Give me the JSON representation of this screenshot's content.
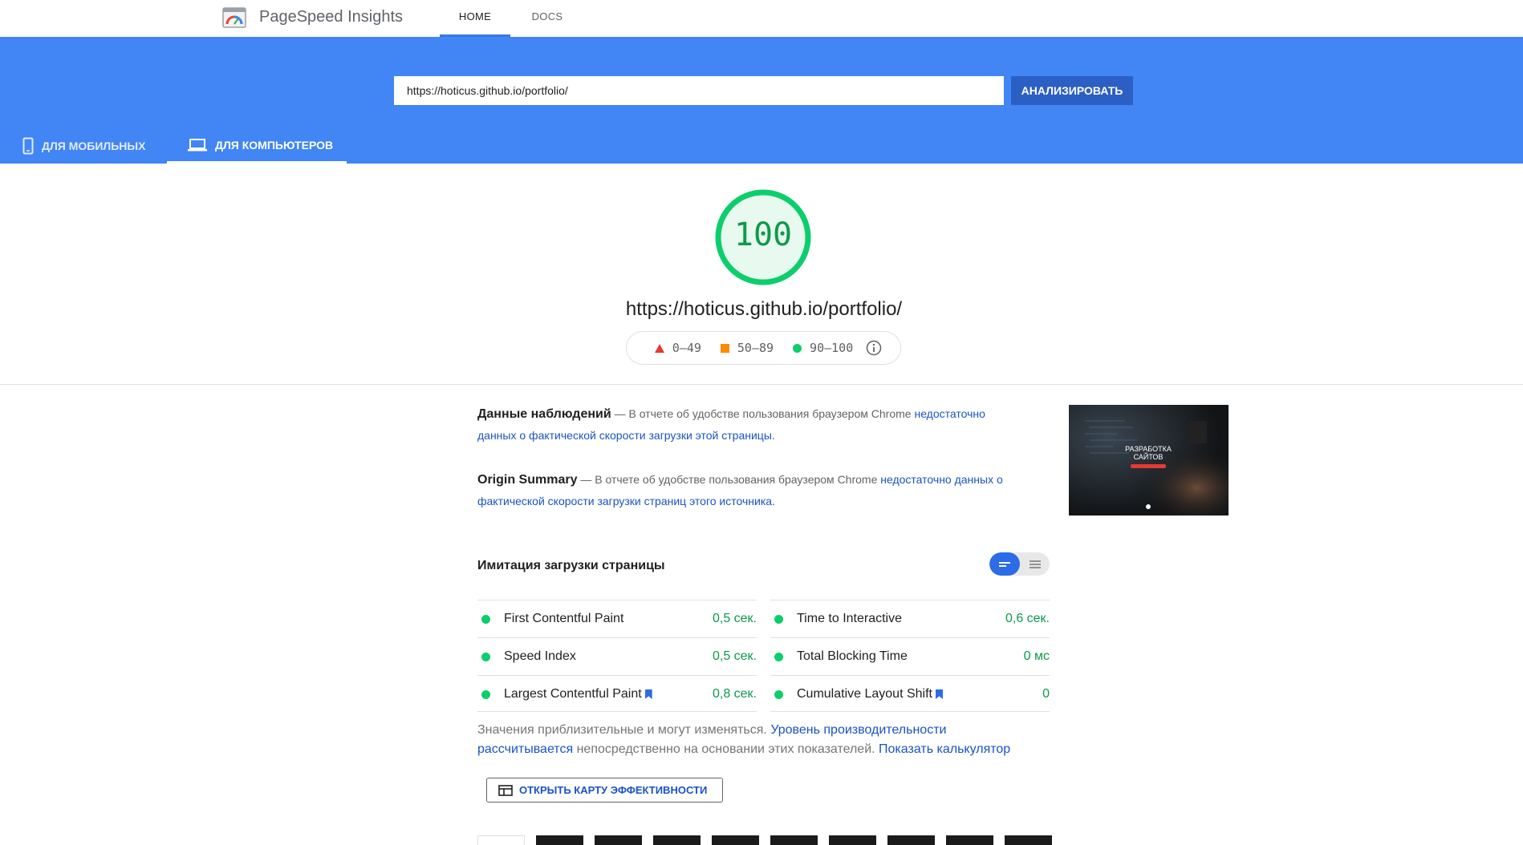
{
  "header": {
    "brand": "PageSpeed Insights",
    "nav": [
      {
        "label": "HOME",
        "active": true
      },
      {
        "label": "DOCS",
        "active": false
      }
    ]
  },
  "search": {
    "url_value": "https://hoticus.github.io/portfolio/",
    "button_label": "АНАЛИЗИРОВАТЬ"
  },
  "device_tabs": [
    {
      "label": "ДЛЯ МОБИЛЬНЫХ",
      "icon": "smartphone-icon",
      "active": false
    },
    {
      "label": "ДЛЯ КОМПЬЮТЕРОВ",
      "icon": "laptop-icon",
      "active": true
    }
  ],
  "score": {
    "value": "100",
    "fraction": 1.0,
    "url": "https://hoticus.github.io/portfolio/",
    "color": "#0cce6b"
  },
  "legend": {
    "fail": "0–49",
    "average": "50–89",
    "pass": "90–100",
    "colors": {
      "fail": "#e53935",
      "average": "#fb8c00",
      "pass": "#0cce6b"
    }
  },
  "field_data": {
    "title": "Данные наблюдений",
    "text": "— В отчете об удобстве пользования браузером Chrome",
    "link": "недостаточно данных о фактической скорости загрузки этой страницы."
  },
  "origin_summary": {
    "title": "Origin Summary",
    "text": "— В отчете об удобстве пользования браузером Chrome",
    "link": "недостаточно данных о фактической скорости загрузки страниц этого источника."
  },
  "screenshot": {
    "heading": "РАЗРАБОТКА",
    "subheading": "САЙТОВ"
  },
  "lab": {
    "title": "Имитация загрузки страницы",
    "metrics_left": [
      {
        "name": "First Contentful Paint",
        "value": "0,5 сек.",
        "bookmark": false
      },
      {
        "name": "Speed Index",
        "value": "0,5 сек.",
        "bookmark": false
      },
      {
        "name": "Largest Contentful Paint",
        "value": "0,8 сек.",
        "bookmark": true
      }
    ],
    "metrics_right": [
      {
        "name": "Time to Interactive",
        "value": "0,6 сек.",
        "bookmark": false
      },
      {
        "name": "Total Blocking Time",
        "value": "0 мс",
        "bookmark": false
      },
      {
        "name": "Cumulative Layout Shift",
        "value": "0",
        "bookmark": true
      }
    ]
  },
  "note": {
    "text1": "Значения приблизительные и могут изменяться.",
    "link1": "Уровень производительности рассчитывается",
    "text2": "непосредственно на основании этих показателей.",
    "link2": "Показать калькулятор"
  },
  "treemap_button": {
    "label": "ОТКРЫТЬ КАРТУ ЭФФЕКТИВНОСТИ"
  }
}
